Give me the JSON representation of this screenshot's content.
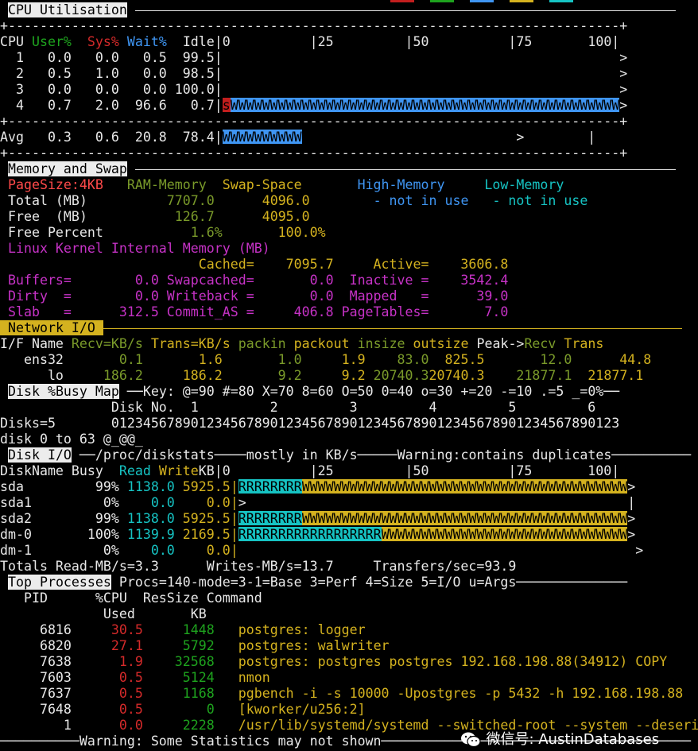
{
  "legend_swatch_colors": [
    "#c21e1e",
    "#1ea31e",
    "#3f95f2",
    "#d4b21f",
    "#16c3c3"
  ],
  "cpu": {
    "title": "CPU Utilisation",
    "col_cpu": "CPU ",
    "col_user": "User% ",
    "col_sys": " Sys% ",
    "col_wait": "Wait% ",
    "col_idle": " Idle|",
    "scale": "0          |25         |50          |75       100|",
    "rows": [
      {
        "text": "  1   0.0   0.0   0.5  99.5|",
        "bar_end": "                                                  >"
      },
      {
        "text": "  2   0.5   1.0   0.0  98.5|",
        "bar_end": "                                                  >"
      },
      {
        "text": "  3   0.0   0.0   0.0 100.0|",
        "bar_end": "                                                  >"
      },
      {
        "text": "  4   0.7   2.0  96.6   0.7|",
        "bar_sys": "s",
        "bar_wait": "WWWWWWWWWWWWWWWWWWWWWWWWWWWWWWWWWWWWWWWWWWWWWWWWW",
        "bar_end": ">"
      }
    ],
    "avg_text": "Avg   0.3   0.6  20.8  78.4|",
    "avg_bar": "WWWWWWWWWW",
    "avg_end": "                           >        |"
  },
  "memory": {
    "title": "Memory and Swap",
    "pagesize": " PageSize:4KB",
    "ram_hdr": "   RAM-Memory",
    "swap_hdr": "  Swap-Space",
    "high_hdr": "       High-Memory",
    "low_hdr": "     Low-Memory",
    "total_label": " Total (MB)",
    "total_ram": "          7707.0",
    "total_swap": "      4096.0",
    "free_label": " Free  (MB)",
    "free_ram": "           126.7",
    "free_swap": "      4095.0",
    "not_in_use_1": "        - not in use",
    "not_in_use_2": "   - not in use",
    "pct_label": " Free Percent",
    "pct_ram": "           1.6%",
    "pct_swap": "       100.0%",
    "kernel_title": " Linux Kernel Internal Memory (MB)",
    "cached_line": "                         Cached=    7095.7     Active=    3606.8",
    "buffers_line": " Buffers=        0.0 Swapcached=       0.0  Inactive =    3542.4",
    "dirty_line": " Dirty  =        0.0 Writeback =       0.0  Mapped   =      39.0",
    "slab_line": " Slab   =      312.5 Commit_AS =     406.8 PageTables=       7.0"
  },
  "network": {
    "title": "Network I/O",
    "hdr_ifname": "I/F Name ",
    "hdr_recv": "Recv=KB/s ",
    "hdr_trans": "Trans=KB/s ",
    "hdr_packin": "packin ",
    "hdr_packout": "packout ",
    "hdr_insize": "insize ",
    "hdr_outsize": "outsize ",
    "hdr_peak": "Peak->",
    "hdr_peak_recv": "Recv ",
    "hdr_peak_trans": "Trans",
    "rows": [
      {
        "name": "   ens32",
        "recv": "       0.1",
        "trans": "       1.6",
        "packin": "       1.0",
        "packout": "     1.9",
        "insize": "    83.0",
        "outsize": "  825.5",
        "peak_recv": "       12.0",
        "peak_trans": "      44.8"
      },
      {
        "name": "      lo",
        "recv": "     186.2",
        "trans": "     186.2",
        "packin": "       9.2",
        "packout": "     9.2",
        "insize": " 20740.3",
        "outsize": "20740.3",
        "peak_recv": "    21877.1",
        "peak_trans": "  21877.1"
      }
    ]
  },
  "diskmap": {
    "title": "Disk %Busy Map",
    "key": "Key: @=90 #=80 X=70 8=60 O=50 0=40 o=30 +=20 -=10 .=5 _=0%",
    "disk_no_line": "              Disk No.  1         2         3         4         5         6",
    "disks_line": "Disks=5       0123456789012345678901234567890123456789012345678901234567890123",
    "map_line": "disk 0 to 63 @_@@_"
  },
  "diskio": {
    "title": "Disk I/O",
    "source": "/proc/diskstats",
    "units": "mostly in KB/s",
    "warning": "Warning:contains duplicates",
    "hdr_name": "DiskName Busy  ",
    "hdr_read": "Read ",
    "hdr_write": "Write",
    "hdr_kb": "KB|",
    "scale": "0          |25         |50          |75       100|",
    "rows": [
      {
        "name": "sda         99% ",
        "read": "1138.0",
        "write": " 5925.5|",
        "bar_r": "RRRRRRRR",
        "bar_w": "WWWWWWWWWWWWWWWWWWWWWWWWWWWWWWWWWWWWWWWWW",
        "bar_end": ">"
      },
      {
        "name": "sda1         0% ",
        "read": "   0.0",
        "write": "    0.0|",
        "bar_end": ">                                                |"
      },
      {
        "name": "sda2        99% ",
        "read": "1138.0",
        "write": " 5925.5|",
        "bar_r": "RRRRRRRR",
        "bar_w": "WWWWWWWWWWWWWWWWWWWWWWWWWWWWWWWWWWWWWWWWW",
        "bar_end": ">"
      },
      {
        "name": "dm-0       100% ",
        "read": "1139.9",
        "write": " 2169.5|",
        "bar_r": "RRRRRRRRRRRRRRRRRR",
        "bar_w": "WWWWWWWWWWWWWWWWWWWWWWWWWWWWWWW",
        "bar_end": ">"
      },
      {
        "name": "dm-1         0% ",
        "read": "   0.0",
        "write": "    0.0|",
        "bar_end": "                                                  >"
      }
    ],
    "totals": "Totals Read-MB/s=3.3      Writes-MB/s=13.7     Transfers/sec=93.9"
  },
  "top": {
    "title": "Top Processes",
    "mode_line": "Procs=140-mode=3-1=Base 3=Perf 4=Size 5=I/O u=Args",
    "hdr1": "   PID      %CPU  ResSize Command",
    "hdr2": "             Used       KB",
    "rows": [
      {
        "pid": "     6816 ",
        "cpu": "    30.5",
        "res": "     1448",
        "cmd": "   postgres: logger"
      },
      {
        "pid": "     6820 ",
        "cpu": "    27.1",
        "res": "     5792",
        "cmd": "   postgres: walwriter"
      },
      {
        "pid": "     7638 ",
        "cpu": "     1.9",
        "res": "    32568",
        "cmd": "   postgres: postgres postgres 192.168.198.88(34912) COPY"
      },
      {
        "pid": "     7603 ",
        "cpu": "     0.5",
        "res": "     5124",
        "cmd": "   nmon"
      },
      {
        "pid": "     7637 ",
        "cpu": "     0.5",
        "res": "     1168",
        "cmd": "   pgbench -i -s 10000 -Upostgres -p 5432 -h 192.168.198.88"
      },
      {
        "pid": "     7648 ",
        "cpu": "     0.5",
        "res": "        0",
        "cmd": "   [kworker/u256:2]"
      },
      {
        "pid": "        1 ",
        "cpu": "     0.0",
        "res": "     2228",
        "cmd": "   /usr/lib/systemd/systemd --switched-root --system --deserial"
      }
    ],
    "footer": "Warning: Some Statistics may not shown"
  },
  "watermark": "微信号: AustinDatabases"
}
